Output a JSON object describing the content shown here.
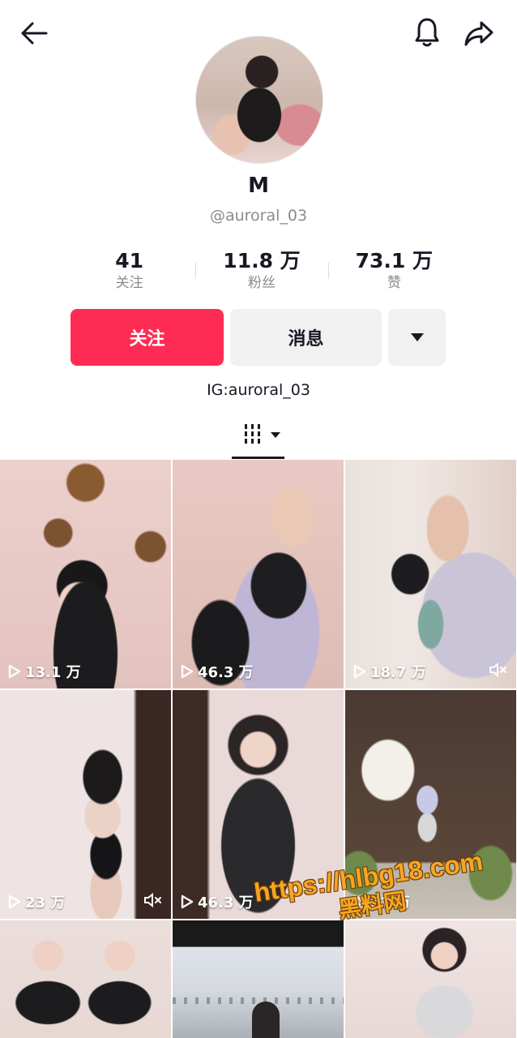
{
  "header": {
    "back_icon": "arrow-left-icon",
    "bell_icon": "bell-icon",
    "share_icon": "share-icon"
  },
  "profile": {
    "name": "M",
    "handle": "@auroral_03",
    "bio": "IG:auroral_03"
  },
  "stats": [
    {
      "value": "41",
      "label": "关注"
    },
    {
      "value": "11.8 万",
      "label": "粉丝"
    },
    {
      "value": "73.1 万",
      "label": "赞"
    }
  ],
  "actions": {
    "follow": "关注",
    "message": "消息"
  },
  "videos": [
    {
      "views": "13.1 万",
      "muted": false
    },
    {
      "views": "46.3 万",
      "muted": false
    },
    {
      "views": "18.7 万",
      "muted": true
    },
    {
      "views": "23 万",
      "muted": true
    },
    {
      "views": "46.3 万",
      "muted": false
    },
    {
      "views": "12 万",
      "muted": false
    },
    {
      "views": "",
      "muted": false
    },
    {
      "views": "",
      "muted": false
    },
    {
      "views": "",
      "muted": false
    }
  ],
  "watermark": {
    "url": "https://hlbg18.com",
    "text": "黑料网"
  },
  "colors": {
    "accent": "#fe2c55",
    "secondary_btn": "#f1f1f2",
    "muted_text": "#8a8b91"
  }
}
